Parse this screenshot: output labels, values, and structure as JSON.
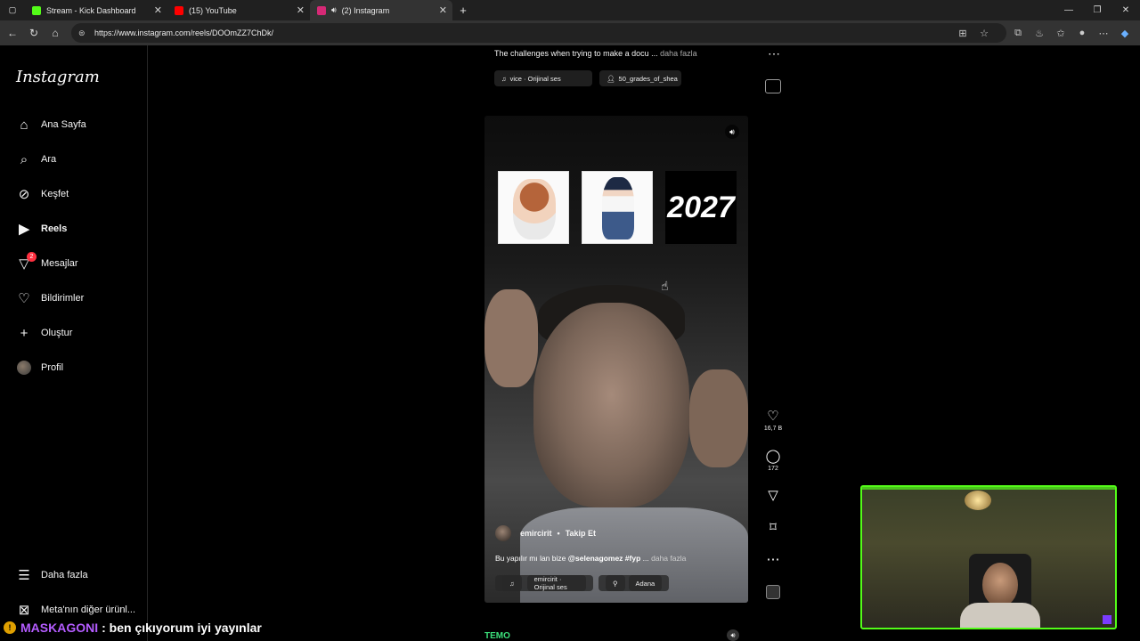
{
  "browser": {
    "tabs": [
      {
        "title": "Stream - Kick Dashboard",
        "fav_color": "#53fc18"
      },
      {
        "title": "(15) YouTube",
        "fav_color": "#ff0000"
      },
      {
        "title": "(2) Instagram",
        "fav_color": "#d62976"
      }
    ],
    "url": "https://www.instagram.com/reels/DOOmZZ7ChDk/"
  },
  "sidebar": {
    "logo": "Instagram",
    "items": [
      {
        "label": "Ana Sayfa"
      },
      {
        "label": "Ara"
      },
      {
        "label": "Keşfet"
      },
      {
        "label": "Reels"
      },
      {
        "label": "Mesajlar",
        "badge": "2"
      },
      {
        "label": "Bildirimler"
      },
      {
        "label": "Oluştur"
      },
      {
        "label": "Profil"
      }
    ],
    "more": "Daha fazla",
    "meta": "Meta'nın diğer ürünl..."
  },
  "prev_reel": {
    "caption": "The challenges when trying to make a docu ...",
    "more": "daha fazla",
    "audio": "vice · Orijinal ses",
    "tagged": "50_grades_of_shea"
  },
  "reel": {
    "thumb_text": "2027",
    "username": "emircirit",
    "follow": "Takip Et",
    "caption_prefix": "Bu yapılır mı lan bize",
    "caption_tags": "@selenagomez #fyp",
    "caption_suffix": "...",
    "more": "daha fazla",
    "audio": "emircirit · Orijinal ses",
    "location": "Adana",
    "likes": "16,7 B",
    "comments": "172"
  },
  "chat": {
    "badge": "!",
    "user": "MASKAGONI",
    "message": ": ben çıkıyorum iyi yayınlar"
  },
  "next_reel": {
    "teaser": "TEMO"
  }
}
